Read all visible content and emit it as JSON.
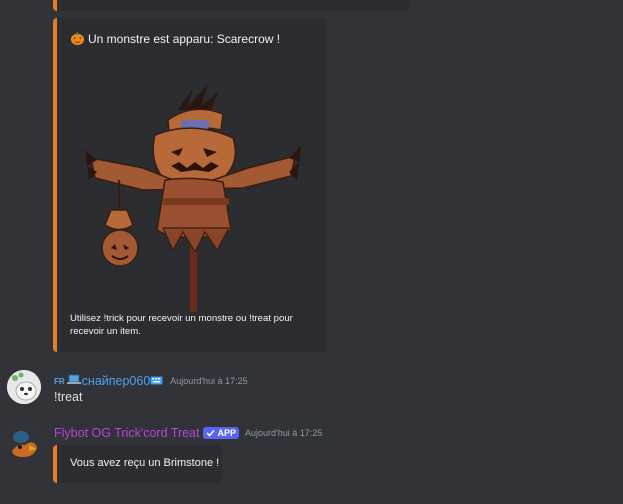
{
  "embed_main": {
    "title": "Un monstre est apparu: Scarecrow !",
    "icon": "pumpkin-icon",
    "description": "Utilisez !trick pour recevoir un monstre ou !treat pour recevoir un item.",
    "accent_color": "#e67e22"
  },
  "user_message": {
    "tag": "FR",
    "username": "снайпер060",
    "timestamp": "Aujourd'hui à 17:25",
    "text": "!treat"
  },
  "bot_message": {
    "username": "Flybot OG Trick'cord Treat",
    "badge": "APP",
    "timestamp": "Aujourd'hui à 17:25",
    "embed_text": "Vous avez reçu un Brimstone !"
  }
}
